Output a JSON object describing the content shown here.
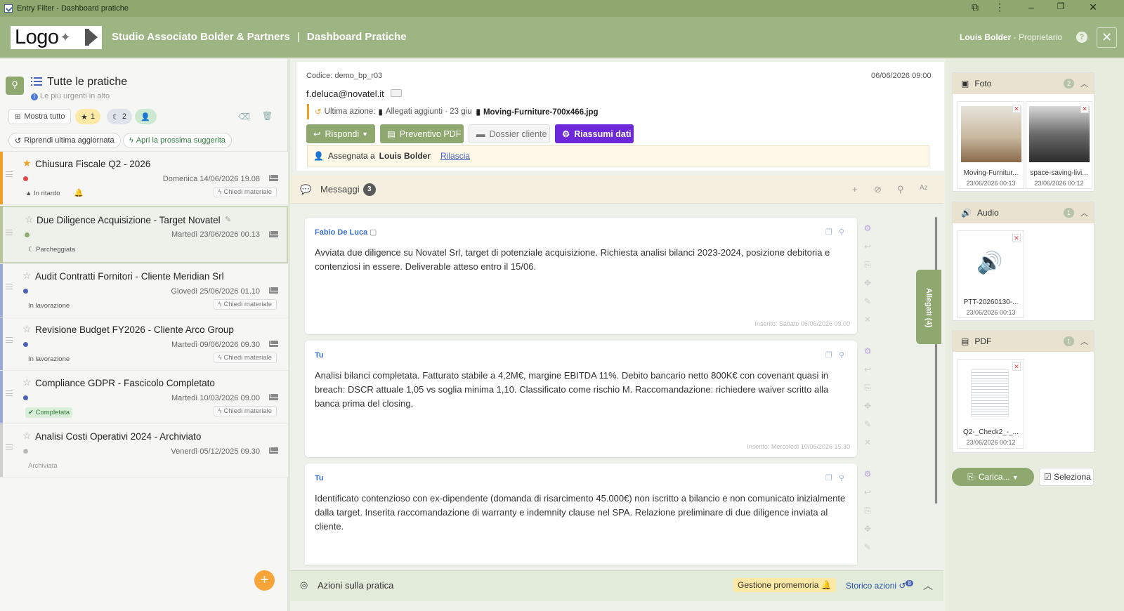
{
  "window": {
    "title": "Entry Filter - Dashboard pratiche"
  },
  "header": {
    "logo": "Logo",
    "studio": "Studio Associato Bolder & Partners",
    "separator": "|",
    "dashboard": "Dashboard Pratiche",
    "user_name": "Louis Bolder",
    "user_role": " - Proprietario",
    "help": "?",
    "close": "✕"
  },
  "left": {
    "title": "Tutte le pratiche",
    "subtitle": "Le più urgenti in alto",
    "show_all": "Mostra tutto",
    "star_count": "1",
    "moon_count": "2",
    "resume_last": "Riprendi ultima aggiornata",
    "open_next": "Apri la prossima suggerita",
    "items": [
      {
        "title": "Chiusura Fiscale Q2 - 2026",
        "date": "Domenica 14/06/2026 19.08",
        "status": "In ritardo",
        "material": "Chiedi materiale"
      },
      {
        "title": "Due Diligence Acquisizione - Target Novatel",
        "date": "Martedì 23/06/2026 00.13",
        "status": "Parcheggiata",
        "material": ""
      },
      {
        "title": "Audit Contratti Fornitori - Cliente Meridian Srl",
        "date": "Giovedì 25/06/2026 01.10",
        "status": "In lavorazione",
        "material": "Chiedi materiale"
      },
      {
        "title": "Revisione Budget FY2026 - Cliente Arco Group",
        "date": "Martedì 09/06/2026 09.30",
        "status": "In lavorazione",
        "material": "Chiedi materiale"
      },
      {
        "title": "Compliance GDPR - Fascicolo Completato",
        "date": "Martedì 10/03/2026 09.00",
        "status": "Completata",
        "material": "Chiedi materiale"
      },
      {
        "title": "Analisi Costi Operativi 2024 - Archiviato",
        "date": "Venerdì 05/12/2025 09.30",
        "status": "Archiviata",
        "material": ""
      }
    ],
    "fab": "+"
  },
  "detail": {
    "codice": "Codice: demo_bp_r03",
    "date": "06/06/2026 09:00",
    "email": "f.deluca@novatel.it",
    "last_action_label": "Ultima azione:",
    "last_action_text": "Allegati aggiunti · 23 giu",
    "last_action_file": "Moving-Furniture-700x466.jpg",
    "btn_reply": "Rispondi",
    "btn_pdf": "Preventivo PDF",
    "btn_dossier": "Dossier cliente",
    "btn_summary": "Riassumi dati",
    "assigned_label": "Assegnata a",
    "assigned_name": "Louis Bolder",
    "release": "Rilascia"
  },
  "messages": {
    "title": "Messaggi",
    "count": "3",
    "list": [
      {
        "author": "Fabio De Luca",
        "text": "Avviata due diligence su Novatel Srl, target di potenziale acquisizione. Richiesta analisi bilanci 2023-2024, posizione debitoria e contenziosi in essere. Deliverable atteso entro il 15/06.",
        "inserted": "Inserito: Sabato 06/06/2026 09.00"
      },
      {
        "author": "Tu",
        "text": "Analisi bilanci completata. Fatturato stabile a 4,2M€, margine EBITDA 11%. Debito bancario netto 800K€ con covenant quasi in breach: DSCR attuale 1,05 vs soglia minima 1,10. Classificato come rischio M. Raccomandazione: richiedere waiver scritto alla banca prima del closing.",
        "inserted": "Inserito: Mercoledì 10/06/2026 15.30"
      },
      {
        "author": "Tu",
        "text": "Identificato contenzioso con ex-dipendente (domanda di risarcimento 45.000€) non iscritto a bilancio e non comunicato inizialmente dalla target. Inserita raccomandazione di warranty e indemnity clause nel SPA. Relazione preliminare di due diligence inviata al cliente.",
        "inserted": ""
      }
    ],
    "allegati_tab": "Allegati (4)"
  },
  "actions": {
    "title": "Azioni sulla pratica",
    "reminder": "Gestione promemoria",
    "history": "Storico azioni",
    "history_count": "8"
  },
  "right": {
    "foto": {
      "title": "Foto",
      "count": "2",
      "files": [
        {
          "name": "Moving-Furnitur...",
          "date": "23/06/2026 00:13"
        },
        {
          "name": "space-saving-livi...",
          "date": "23/06/2026 00:12"
        }
      ]
    },
    "audio": {
      "title": "Audio",
      "count": "1",
      "files": [
        {
          "name": "PTT-20260130-...",
          "date": "23/06/2026 00:13"
        }
      ]
    },
    "pdf": {
      "title": "PDF",
      "count": "1",
      "files": [
        {
          "name": "Q2-_Check2_-_...",
          "date": "23/06/2026 00:12"
        }
      ]
    },
    "upload": "Carica...",
    "select": "Seleziona"
  },
  "colors": {
    "accent": "#8fa86f",
    "header": "#9db582",
    "purple": "#6d28d9",
    "star": "#f0a023"
  }
}
